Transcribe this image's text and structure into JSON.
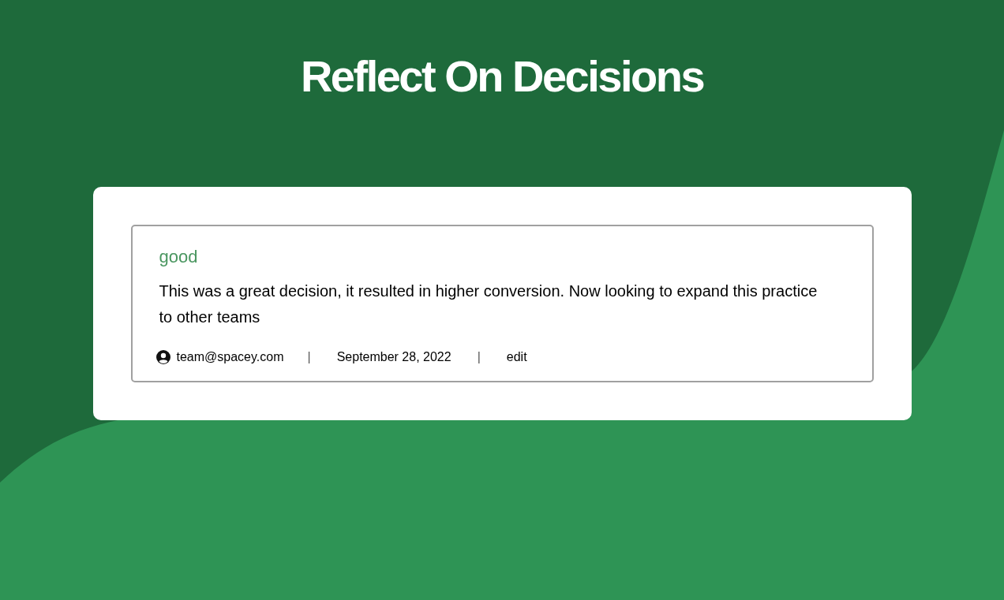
{
  "title": "Reflect On Decisions",
  "entries": [
    {
      "tag": "good",
      "text": "This was a great decision, it resulted in higher conversion. Now looking to expand this practice to other teams",
      "author": "team@spacey.com",
      "separator_1": "|",
      "date": "September 28, 2022",
      "separator_2": "|",
      "action": "edit"
    }
  ]
}
